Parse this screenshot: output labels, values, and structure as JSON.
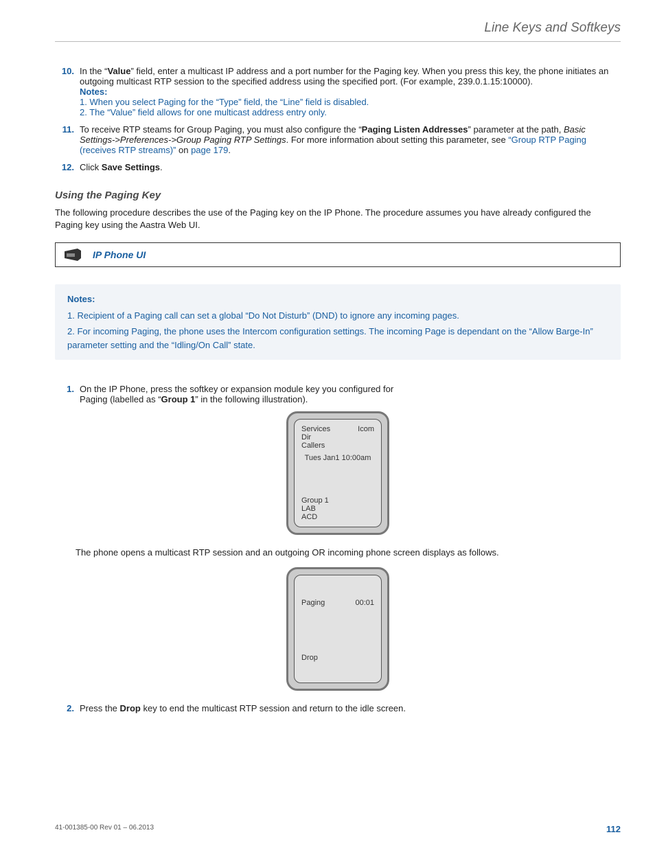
{
  "header": {
    "title": "Line Keys and Softkeys"
  },
  "steps": {
    "s10": {
      "num": "10.",
      "pre": "In the “",
      "bold1": "Value",
      "post": "” field, enter a multicast IP address and a port number for the Paging key. When you press this key, the phone initiates an outgoing multicast RTP session to the specified address using the specified port. (For example, 239.0.1.15:10000).",
      "notes_label": "Notes:",
      "note1": "1. When you select Paging for the “Type” field, the “Line” field is disabled.",
      "note2": "2. The “Value” field allows for one multicast address entry only."
    },
    "s11": {
      "num": "11.",
      "pre": "To receive RTP steams for Group Paging, you must also configure the “",
      "bold1": "Paging Listen Addresses",
      "mid": "” parameter at the path, ",
      "italic": "Basic Settings->Preferences->Group Paging RTP Settings",
      "post": ". For more information about setting this parameter, see ",
      "link": "“Group RTP Paging (receives RTP streams)”",
      "on": " on ",
      "pageref": "page 179",
      "end": "."
    },
    "s12": {
      "num": "12.",
      "pre": "Click ",
      "bold1": "Save Settings",
      "post": "."
    }
  },
  "subheading": "Using the Paging Key",
  "proc_text": "The following procedure describes the use of the Paging key on the IP Phone. The procedure assumes you have already configured the Paging key using the Aastra Web UI.",
  "ui_box_label": "IP Phone UI",
  "notes_box": {
    "title": "Notes:",
    "n1": "1. Recipient of a Paging call can set a global “Do Not Disturb” (DND) to ignore any incoming pages.",
    "n2": "2. For incoming Paging, the phone uses the Intercom configuration settings. The incoming Page is dependant on the “Allow Barge-In” parameter setting and the “Idling/On Call” state."
  },
  "proc_steps": {
    "p1": {
      "num": "1.",
      "l1": "On the IP Phone, press the softkey or expansion module key you configured for",
      "l2a": "Paging (labelled as “",
      "l2b": "Group 1",
      "l2c": "” in the following illustration)."
    },
    "p2": {
      "num": "2.",
      "pre": "Press the ",
      "bold": "Drop",
      "post": " key to end the multicast RTP session and return to the idle screen."
    }
  },
  "screens": {
    "idle": {
      "topLeft1": "Services",
      "topLeft2": "Dir",
      "topLeft3": "Callers",
      "topRight": "Icom",
      "date": "Tues Jan1 10:00am",
      "b1": "Group 1",
      "b2": "LAB",
      "b3": "ACD"
    },
    "result_text": "The phone opens a multicast RTP session and an outgoing OR incoming phone screen displays as follows.",
    "paging": {
      "label": "Paging",
      "timer": "00:01",
      "drop": "Drop"
    }
  },
  "footer": {
    "rev": "41-001385-00 Rev 01 – 06.2013",
    "page": "112"
  }
}
